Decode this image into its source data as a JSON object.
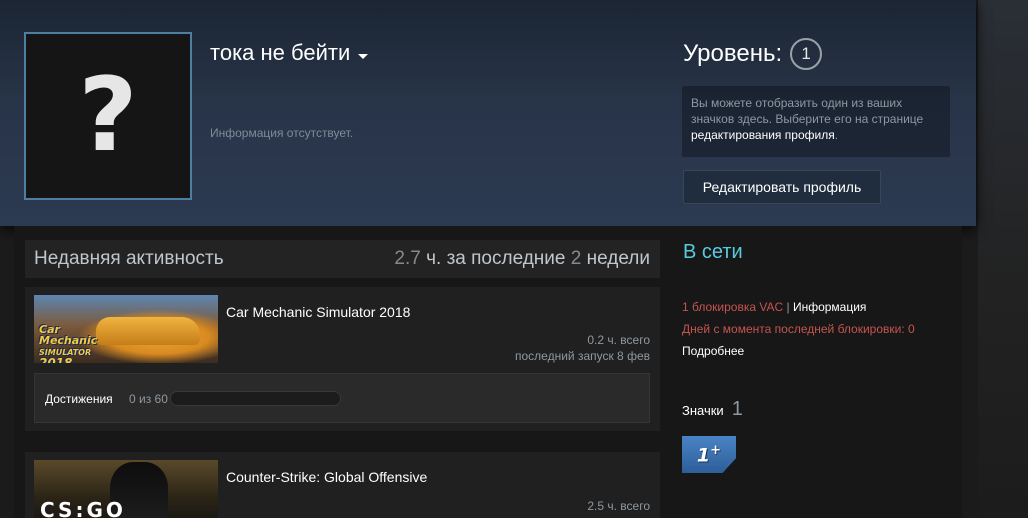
{
  "profile": {
    "persona_name": "тока не бейти",
    "summary": "Информация отсутствует.",
    "avatar_symbol": "?",
    "level_label": "Уровень:",
    "level": "1",
    "showcase_text": "Вы можете отобразить один из ваших значков здесь. Выберите его на странице ",
    "showcase_link": "редактирования профиля",
    "showcase_end": ".",
    "edit_button": "Редактировать профиль"
  },
  "activity": {
    "title": "Недавняя активность",
    "hours_num": "2.7",
    "hours_text": "ч. за последние",
    "weeks_num": "2",
    "weeks_text": "недели",
    "games": [
      {
        "name": "Car Mechanic Simulator 2018",
        "hours": "0.2 ч. всего",
        "last_played": "последний запуск 8 фев",
        "achievements_label": "Достижения",
        "achievements_count": "0 из 60",
        "achievements_progress": 0,
        "capsule_text_1": "Car",
        "capsule_text_2": "Mechanic",
        "capsule_text_3": "SIMULATOR",
        "capsule_text_4": "2018"
      },
      {
        "name": "Counter-Strike: Global Offensive",
        "hours": "2.5 ч. всего",
        "capsule_text": "CS:GO"
      }
    ]
  },
  "sidebar": {
    "status": "В сети",
    "vac_count": "1 блокировка VAC",
    "vac_sep": "|",
    "vac_info": "Информация",
    "days_since": "Дней с момента последней блокировки: 0",
    "more": "Подробнее",
    "badges_label": "Значки",
    "badges_count": "1",
    "badge_text": "1",
    "badge_plus": "+"
  },
  "colors": {
    "online": "#57cbde",
    "vac": "#c6544f",
    "header_bg": "#2c3a52"
  }
}
